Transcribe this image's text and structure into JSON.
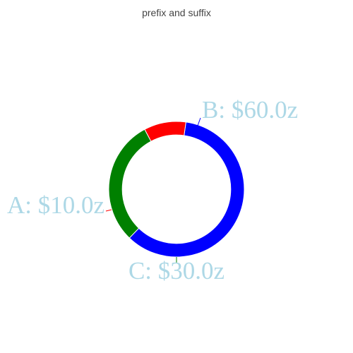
{
  "chart_data": {
    "type": "pie",
    "title": "prefix and suffix",
    "hole": 0.8,
    "labels": [
      "A",
      "B",
      "C"
    ],
    "values": [
      10,
      60,
      30
    ],
    "colors": [
      "#ff0000",
      "#0000ff",
      "#008000"
    ],
    "text_labels": [
      "A: $10.0z",
      "B: $60.0z",
      "C: $30.0z"
    ],
    "label_color": "#add8e6",
    "slice_border_color": "#ffffff",
    "leader_line_colors": [
      "#ff0000",
      "#0000ff",
      "#008000"
    ]
  }
}
